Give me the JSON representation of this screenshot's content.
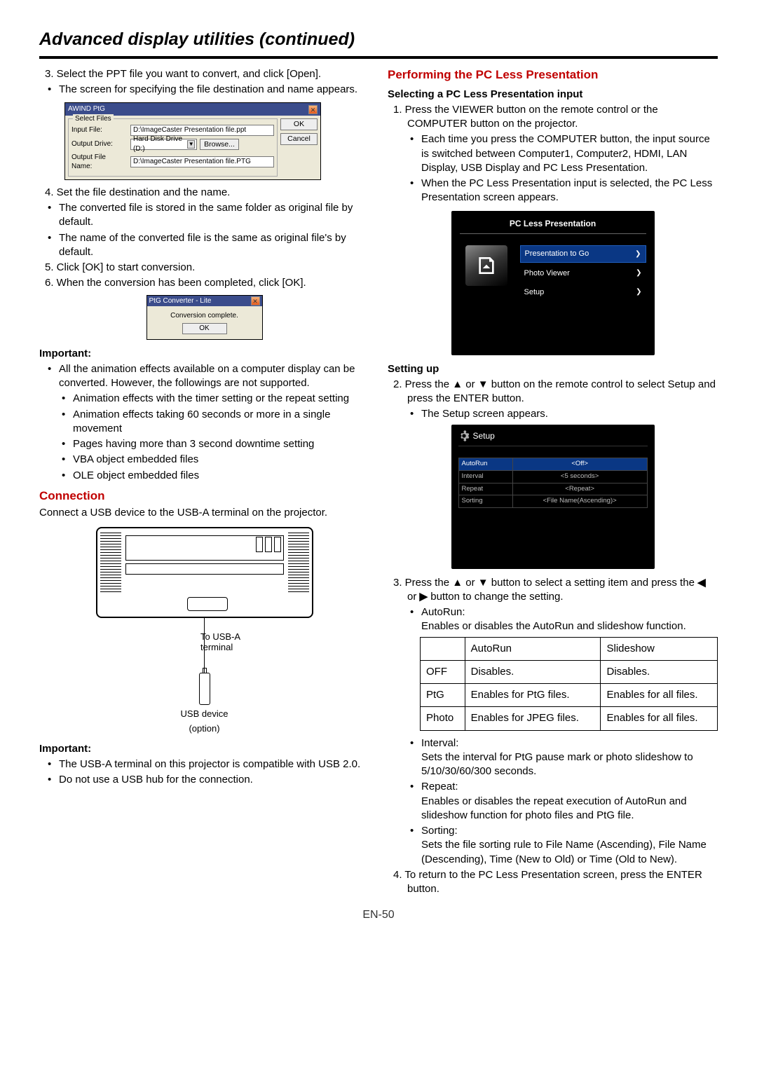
{
  "page_title": "Advanced display utilities (continued)",
  "page_number": "EN-50",
  "left": {
    "step3": "3. Select the PPT file you want to convert, and click [Open].",
    "step3_bullet": "The screen for specifying the file destination and name appears.",
    "step4": "4. Set the file destination and the name.",
    "step4_b1": "The converted file is stored in the same folder as original file by default.",
    "step4_b2": "The name of the converted file is the same as original file's by default.",
    "step5": "5. Click [OK] to start conversion.",
    "step6": "6. When the conversion has been completed, click [OK].",
    "important": "Important:",
    "imp_b1": "All the animation effects available on a computer display can be converted. However, the followings are not supported.",
    "imp_s1": "Animation effects with the timer setting or the repeat setting",
    "imp_s2": "Animation effects taking 60 seconds or more  in a single movement",
    "imp_s3": "Pages having more than 3 second downtime setting",
    "imp_s4": "VBA object embedded files",
    "imp_s5": "OLE object embedded files",
    "connection_h": "Connection",
    "connection_p": "Connect a USB device to the USB-A terminal on the projector.",
    "usb_a": "To USB-A terminal",
    "usb_dev": "USB device",
    "usb_opt": "(option)",
    "important2": "Important:",
    "imp2_b1": "The USB-A terminal on this projector is compatible with USB 2.0.",
    "imp2_b2": "Do not use a USB hub for the connection."
  },
  "dlg1": {
    "title": "AWIND PtG",
    "fs_label": "Select Files",
    "lbl_input": "Input  File:",
    "val_input": "D:\\ImageCaster Presentation file.ppt",
    "lbl_drive": "Output Drive:",
    "val_drive": "Hard Disk Drive (D:)",
    "btn_browse": "Browse...",
    "lbl_out": "Output File Name:",
    "val_out": "D:\\ImageCaster Presentation file.PTG",
    "btn_ok": "OK",
    "btn_cancel": "Cancel"
  },
  "dlg2": {
    "title": "PtG Converter - Lite",
    "msg": "Conversion complete.",
    "btn_ok": "OK"
  },
  "right": {
    "head1": "Performing the PC Less Presentation",
    "head2": "Selecting a PC Less Presentation input",
    "step1": "1. Press the VIEWER button on the remote control or the COMPUTER button on the projector.",
    "s1_b1": "Each time you press the COMPUTER button, the input source is switched between Computer1, Computer2, HDMI, LAN Display, USB Display and PC Less Presentation.",
    "s1_b2": "When the PC Less Presentation input is selected, the PC Less Presentation screen appears.",
    "head3": "Setting up",
    "step2": "2. Press the ▲ or ▼ button on the remote control to select Setup and press the ENTER button.",
    "s2_b1": "The Setup screen appears.",
    "step3_a": "3. Press the ▲ or ▼ button to select a setting item and press the ",
    "step3_b": " or ",
    "step3_c": " button to change the setting.",
    "s3_autorun_h": "AutoRun:",
    "s3_autorun_p": "Enables or disables the AutoRun and slideshow function.",
    "s3_interval_h": "Interval:",
    "s3_interval_p": "Sets the interval for PtG pause mark or photo slideshow to 5/10/30/60/300 seconds.",
    "s3_repeat_h": "Repeat:",
    "s3_repeat_p": "Enables or disables the repeat execution of AutoRun and slideshow function for photo files and PtG file.",
    "s3_sorting_h": "Sorting:",
    "s3_sorting_p": "Sets the file sorting rule to File Name (Ascending), File Name (Descending), Time (New to Old) or Time (Old to New).",
    "step4": "4. To return to the PC Less Presentation screen, press the ENTER button."
  },
  "blk": {
    "title": "PC Less Presentation",
    "m1": "Presentation to Go",
    "m2": "Photo Viewer",
    "m3": "Setup"
  },
  "blk2": {
    "title": "Setup",
    "r1a": "AutoRun",
    "r1b": "<Off>",
    "r2a": "Interval",
    "r2b": "<5 seconds>",
    "r3a": "Repeat",
    "r3b": "<Repeat>",
    "r4a": "Sorting",
    "r4b": "<File Name(Ascending)>"
  },
  "autorun_table": {
    "h1": "",
    "h2": "AutoRun",
    "h3": "Slideshow",
    "r1c1": "OFF",
    "r1c2": "Disables.",
    "r1c3": "Disables.",
    "r2c1": "PtG",
    "r2c2": "Enables for PtG files.",
    "r2c3": "Enables for all files.",
    "r3c1": "Photo",
    "r3c2": "Enables for JPEG files.",
    "r3c3": "Enables for all files."
  }
}
